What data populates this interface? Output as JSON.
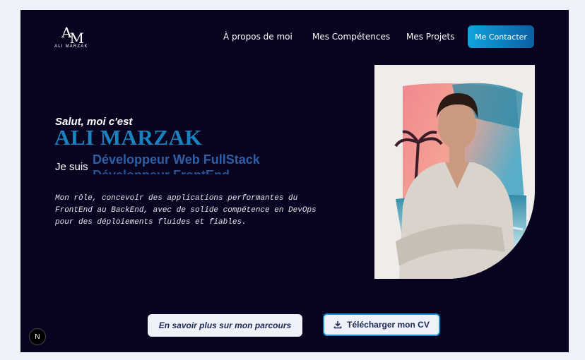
{
  "logo": {
    "mark_a": "A",
    "mark_m": "M",
    "text": "ALI MARZAK"
  },
  "nav": {
    "items": [
      {
        "label": "À propos de moi"
      },
      {
        "label": "Mes Compétences"
      },
      {
        "label": "Mes Projets"
      }
    ],
    "contact_label": "Me Contacter"
  },
  "hero": {
    "greeting": "Salut, moi c'est",
    "name": "ALI MARZAK",
    "je_suis": "Je suis",
    "roles": [
      "Développeur Web FullStack",
      "Développeur FrontEnd"
    ],
    "description": "Mon rôle, concevoir des applications performantes du FrontEnd au BackEnd, avec de solide compétence en DevOps pour des déploiements fluides et fiables."
  },
  "buttons": {
    "parcours": "En savoir plus sur mon parcours",
    "cv": "Télécharger mon CV"
  },
  "badge": {
    "label": "N"
  },
  "colors": {
    "background": "#08041f",
    "accent": "#1a83bf",
    "role_text": "#2d5fa8",
    "contact_gradient_start": "#0fa4dd",
    "contact_gradient_end": "#0c5fa3"
  },
  "icons": {
    "download": "download-icon",
    "portrait": "profile-portrait"
  }
}
